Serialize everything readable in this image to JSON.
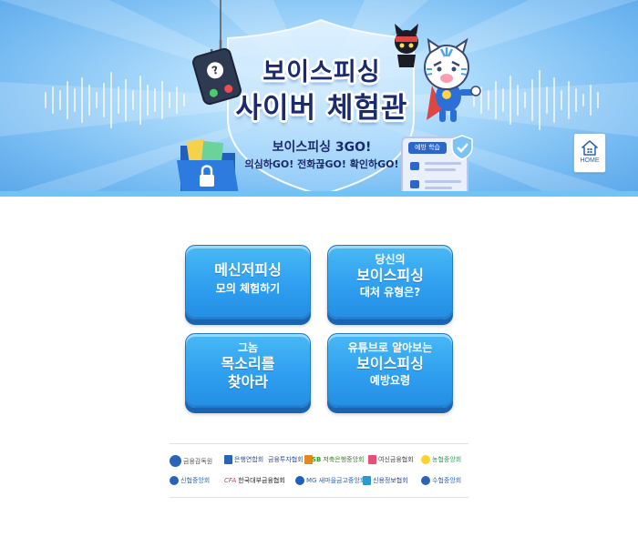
{
  "banner": {
    "title_line1": "보이스피싱",
    "title_line2": "사이버 체험관",
    "subtitle": "보이스피싱 3GO!",
    "slogan": "의심하GO! 전화끊GO! 확인하GO!",
    "doc_tag": "예방 학습"
  },
  "home": {
    "label": "HOME"
  },
  "menu": [
    {
      "lines": [
        "메신저피싱",
        "모의 체험하기"
      ]
    },
    {
      "lines": [
        "당신의",
        "보이스피싱",
        "대처 유형은?"
      ]
    },
    {
      "lines": [
        "그놈",
        "목소리를",
        "찾아라"
      ]
    },
    {
      "lines": [
        "유튜브로 알아보는",
        "보이스피싱",
        "예방요령"
      ]
    }
  ],
  "partners": {
    "row1": [
      "금융감독원",
      "은행연합회",
      "금융투자협회",
      "저축은행중앙회",
      "여신금융협회",
      "농협중앙회"
    ],
    "row2": [
      "신협중앙회",
      "한국대부금융협회",
      "MG 새마을금고중앙회",
      "신용정보협회",
      "수협중앙회"
    ],
    "logo_marks": {
      "cfa": "CFA",
      "mg": "MG",
      "sb": "SB"
    }
  },
  "colors": {
    "banner_bg": "#74baf2",
    "title_navy": "#1b2c6e",
    "button_blue": "#2f9ff0",
    "button_shadow": "#1a63b0"
  }
}
